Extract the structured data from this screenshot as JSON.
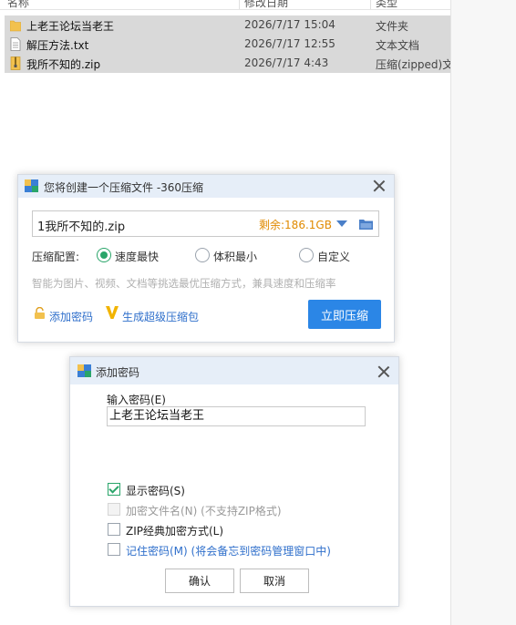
{
  "explorer": {
    "columns": {
      "name": "名称",
      "date": "修改日期",
      "type": "类型"
    },
    "files": [
      {
        "name": "上老王论坛当老王",
        "date": "2026/7/17 15:04",
        "type": "文件夹",
        "icon": "folder-icon"
      },
      {
        "name": "解压方法.txt",
        "date": "2026/7/17 12:55",
        "type": "文本文档",
        "icon": "text-file-icon"
      },
      {
        "name": "我所不知的.zip",
        "date": "2026/7/17 4:43",
        "type": "压缩(zipped)文",
        "icon": "zip-file-icon"
      }
    ]
  },
  "compress_dialog": {
    "title": "您将创建一个压缩文件 -360压缩",
    "path": "1我所不知的.zip",
    "free_space": "剩余:186.1GB",
    "config_label": "压缩配置:",
    "options": [
      {
        "label": "速度最快",
        "selected": true
      },
      {
        "label": "体积最小",
        "selected": false
      },
      {
        "label": "自定义",
        "selected": false
      }
    ],
    "hint": "智能为图片、视频、文档等挑选最优压缩方式，兼具速度和压缩率",
    "add_password": "添加密码",
    "super_pack": "生成超级压缩包",
    "compress_now": "立即压缩"
  },
  "password_dialog": {
    "title": "添加密码",
    "input_label": "输入密码(E)",
    "password_value": "上老王论坛当老王",
    "options": [
      {
        "label": "显示密码(S)",
        "checked": true,
        "disabled": false
      },
      {
        "label": "加密文件名(N) (不支持ZIP格式)",
        "checked": false,
        "disabled": true
      },
      {
        "label": "ZIP经典加密方式(L)",
        "checked": false,
        "disabled": false
      },
      {
        "label": "记住密码(M) (将会备忘到密码管理窗口中)",
        "checked": false,
        "disabled": false
      }
    ],
    "ok": "确认",
    "cancel": "取消"
  },
  "colors": {
    "accent": "#2b86e6",
    "link": "#2f6fcb",
    "check": "#2aa56a",
    "free_space": "#e08a00",
    "selected_row": "#d9d9d9"
  }
}
